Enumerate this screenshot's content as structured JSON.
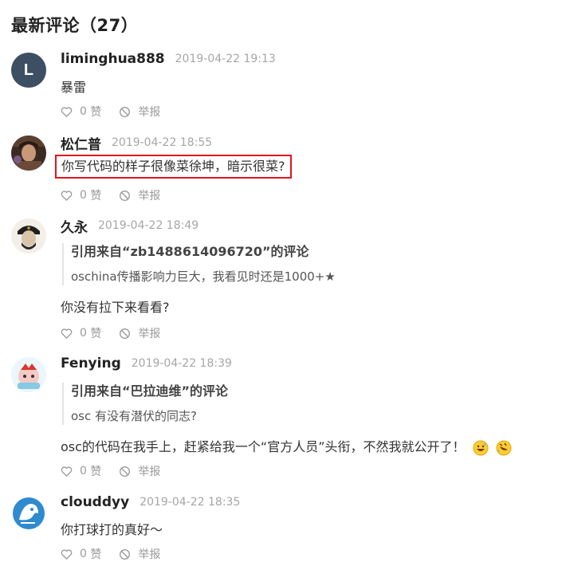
{
  "section": {
    "title": "最新评论（27）"
  },
  "comments": [
    {
      "author": "liminghua888",
      "avatar_letter": "L",
      "time": "2019-04-22 19:13",
      "content": "暴雷",
      "like_count": "0",
      "like_label": "赞",
      "report_label": "举报"
    },
    {
      "author": "松仁普",
      "time": "2019-04-22 18:55",
      "content": "你写代码的样子很像菜徐坤，暗示很菜?",
      "like_count": "0",
      "like_label": "赞",
      "report_label": "举报"
    },
    {
      "author": "久永",
      "time": "2019-04-22 18:49",
      "quote_title": "引用来自“zb1488614096720”的评论",
      "quote_body": "oschina传播影响力巨大，我看见时还是1000+★",
      "content": "你没有拉下来看看?",
      "like_count": "0",
      "like_label": "赞",
      "report_label": "举报"
    },
    {
      "author": "Fenying",
      "time": "2019-04-22 18:39",
      "quote_title": "引用来自“巴拉迪维”的评论",
      "quote_body": "osc 有没有潜伏的同志?",
      "content": "osc的代码在我手上，赶紧给我一个“官方人员”头衔，不然我就公开了！",
      "like_count": "0",
      "like_label": "赞",
      "report_label": "举报"
    },
    {
      "author": "clouddyy",
      "time": "2019-04-22 18:35",
      "content": "你打球打的真好～",
      "like_count": "0",
      "like_label": "赞",
      "report_label": "举报"
    }
  ],
  "colors": {
    "highlight_border": "#e3141c",
    "meta_gray": "#a6a6a6",
    "avatar_letter_bg": "#3d4f63"
  },
  "icons": {
    "like": "heart-outline-icon",
    "report": "ban-circle-icon",
    "emoji_1": "grinning-sweat-emoji",
    "emoji_2": "rolling-laughing-emoji"
  }
}
